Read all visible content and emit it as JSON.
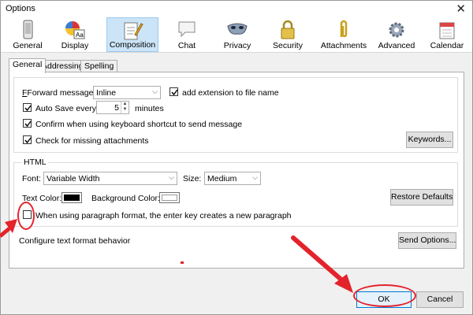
{
  "window": {
    "title": "Options",
    "close_glyph": "✕"
  },
  "toolbar": {
    "panes": [
      {
        "label": "General",
        "icon": "phone-icon",
        "selected": false
      },
      {
        "label": "Display",
        "icon": "color-palette-icon",
        "selected": false
      },
      {
        "label": "Composition",
        "icon": "notepad-pencil-icon",
        "selected": true
      },
      {
        "label": "Chat",
        "icon": "chat-bubble-icon",
        "selected": false
      },
      {
        "label": "Privacy",
        "icon": "mask-icon",
        "selected": false
      },
      {
        "label": "Security",
        "icon": "padlock-icon",
        "selected": false
      },
      {
        "label": "Attachments",
        "icon": "paperclip-icon",
        "selected": false
      },
      {
        "label": "Advanced",
        "icon": "gear-icon",
        "selected": false
      },
      {
        "label": "Calendar",
        "icon": "calendar-icon",
        "selected": false
      }
    ]
  },
  "subtabs": [
    "General",
    "Addressing",
    "Spelling"
  ],
  "general": {
    "forward_label": "Forward messages:",
    "forward_value": "Inline",
    "add_extension_label": "add extension to file name",
    "autosave_label": "Auto Save every",
    "autosave_value": "5",
    "autosave_unit": "minutes",
    "confirm_label": "Confirm when using keyboard shortcut to send message",
    "missing_label": "Check for missing attachments",
    "keywords_button": "Keywords..."
  },
  "html": {
    "group_title": "HTML",
    "font_label": "Font:",
    "font_value": "Variable Width",
    "size_label": "Size:",
    "size_value": "Medium",
    "text_color_label": "Text Color:",
    "text_color": "#000000",
    "bg_color_label": "Background Color:",
    "bg_color": "#ffffff",
    "restore_button": "Restore Defaults",
    "paragraph_label": "When using paragraph format, the enter key creates a new paragraph"
  },
  "send": {
    "configure_label": "Configure text format behavior",
    "send_options_button": "Send Options..."
  },
  "footer": {
    "ok_button": "OK",
    "cancel_button": "Cancel"
  },
  "annotations": {
    "color": "#e3232b"
  }
}
